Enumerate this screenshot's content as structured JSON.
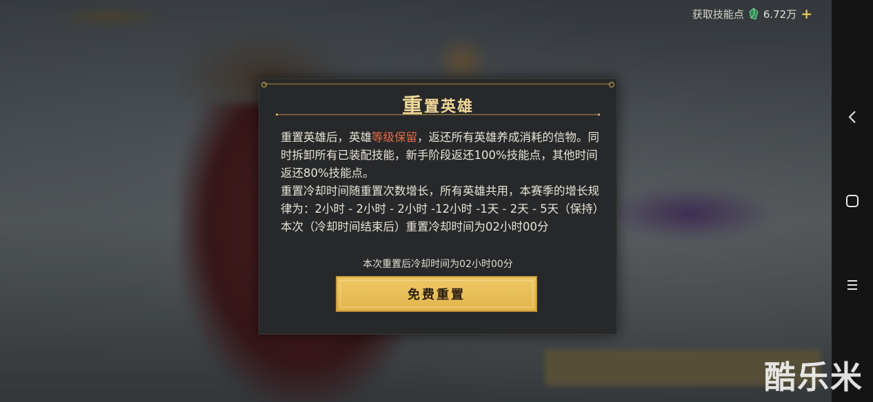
{
  "resource": {
    "label": "获取技能点",
    "amount": "6.72万",
    "plus": "+",
    "icon": "green-gem-icon"
  },
  "dialog": {
    "title_big": "重",
    "title_rest": "置英雄",
    "body": {
      "p1_before": "重置英雄后，英雄",
      "p1_highlight": "等级保留",
      "p1_after": "，返还所有英雄养成消耗的信物。同时拆卸所有已装配技能，新手阶段返还100%技能点，其他时间返还80%技能点。",
      "p2": "重置冷却时间随重置次数增长，所有英雄共用，本赛季的增长规律为：2小时 - 2小时 - 2小时 -12小时 -1天 - 2天 - 5天（保持）",
      "p3": "本次（冷却时间结束后）重置冷却时间为02小时00分"
    },
    "note": "本次重置后冷却时间为02小时00分",
    "button_label": "免费重置"
  },
  "navbar": {
    "icons": [
      "back-chevron-icon",
      "home-square-icon",
      "menu-lines-icon"
    ]
  },
  "watermark": "酷乐米",
  "colors": {
    "highlight": "#e46b47",
    "title_gold": "#f2d99a",
    "button_gold": "#e8bd58"
  }
}
